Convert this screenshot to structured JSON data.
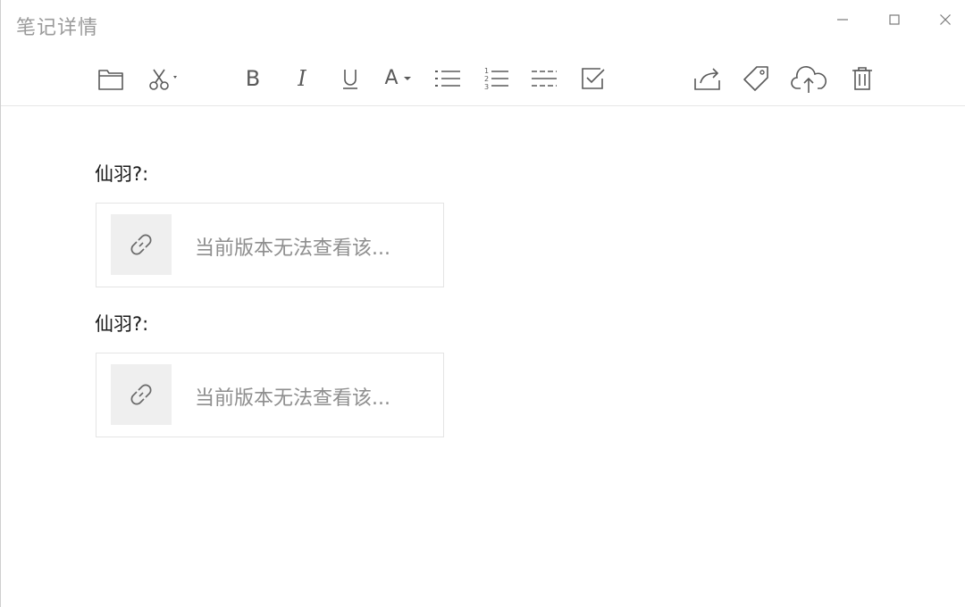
{
  "window": {
    "title": "笔记详情",
    "controls": {
      "minimize_icon": "minimize-icon",
      "maximize_icon": "maximize-icon",
      "close_icon": "close-icon"
    }
  },
  "toolbar": {
    "buttons": [
      {
        "name": "open-folder",
        "icon": "folder-icon"
      },
      {
        "name": "cut",
        "icon": "scissors-icon"
      },
      {
        "name": "bold",
        "icon": "bold-icon",
        "label": "B"
      },
      {
        "name": "italic",
        "icon": "italic-icon",
        "label": "I"
      },
      {
        "name": "underline",
        "icon": "underline-icon"
      },
      {
        "name": "font-color",
        "icon": "font-color-icon",
        "label": "A"
      },
      {
        "name": "bullet-list",
        "icon": "bullet-list-icon"
      },
      {
        "name": "numbered-list",
        "icon": "numbered-list-icon"
      },
      {
        "name": "divider",
        "icon": "divider-icon"
      },
      {
        "name": "checkbox",
        "icon": "checkbox-icon"
      },
      {
        "name": "share",
        "icon": "share-icon"
      },
      {
        "name": "tag",
        "icon": "tag-icon"
      },
      {
        "name": "upload",
        "icon": "cloud-upload-icon"
      },
      {
        "name": "delete",
        "icon": "trash-icon"
      }
    ],
    "number_labels": [
      "1",
      "2",
      "3"
    ]
  },
  "messages": [
    {
      "sender": "仙羽?:",
      "card_text": "当前版本无法查看该...",
      "card_icon": "link-icon"
    },
    {
      "sender": "仙羽?:",
      "card_text": "当前版本无法查看该...",
      "card_icon": "link-icon"
    }
  ],
  "colors": {
    "title": "#9a9a9a",
    "icon": "#5a5a5a",
    "card_border": "#e4e4e4",
    "card_thumb": "#efefef",
    "card_text": "#8e8e8e"
  }
}
